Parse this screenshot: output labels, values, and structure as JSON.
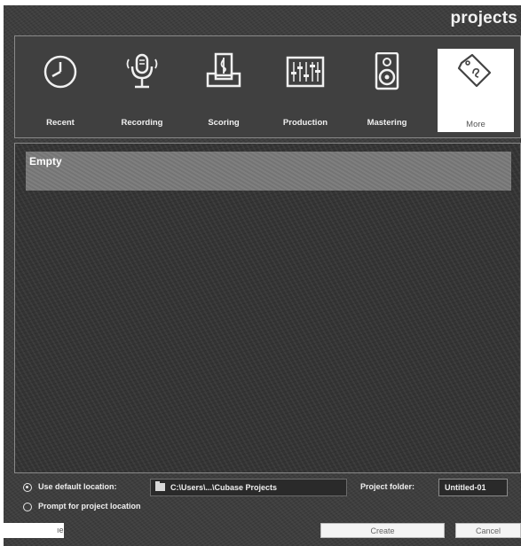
{
  "window": {
    "title": "projects"
  },
  "categories": [
    {
      "label": "Recent",
      "icon": "clock-icon",
      "selected": false
    },
    {
      "label": "Recording",
      "icon": "microphone-icon",
      "selected": false
    },
    {
      "label": "Scoring",
      "icon": "music-sheet-icon",
      "selected": false
    },
    {
      "label": "Production",
      "icon": "mixer-faders-icon",
      "selected": false
    },
    {
      "label": "Mastering",
      "icon": "speaker-icon",
      "selected": false
    },
    {
      "label": "More",
      "icon": "tag-icon",
      "selected": true
    }
  ],
  "templates": {
    "items": [
      {
        "name": "Empty",
        "selected": true
      }
    ]
  },
  "location": {
    "use_default_label": "Use default location:",
    "default_path": "C:\\Users\\...\\Cubase Projects",
    "prompt_label": "Prompt for project location",
    "use_default_selected": true,
    "project_folder_label": "Project folder:",
    "project_folder_value": "Untitled-01"
  },
  "footer": {
    "left_button_partial": "ıer",
    "create_label": "Create",
    "cancel_label": "Cancel"
  },
  "colors": {
    "background": "#3c3c3c",
    "selected_tile": "#ffffff",
    "template_row": "#7a7a7a"
  }
}
